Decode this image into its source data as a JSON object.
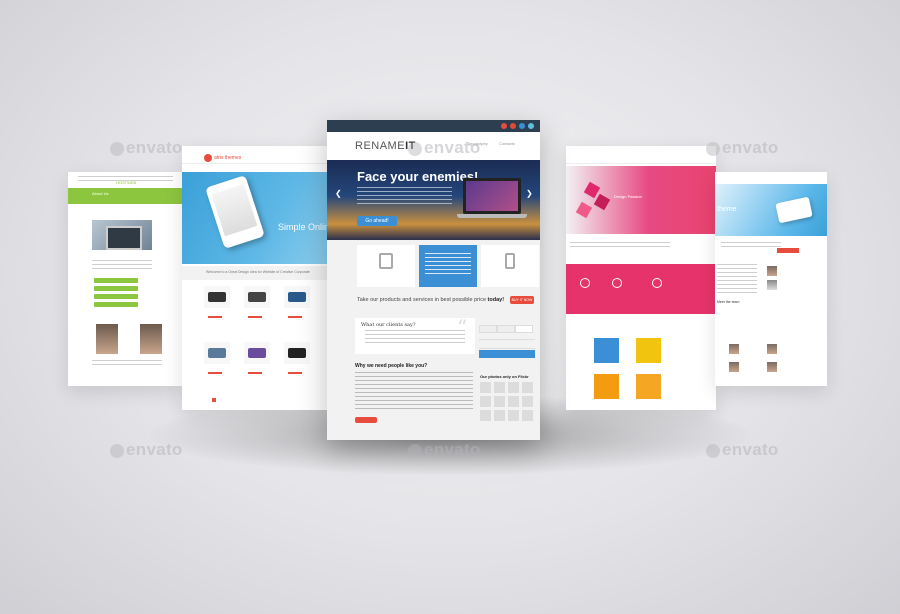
{
  "left_page": {
    "nav_label": "HOSTWEB",
    "section_title": "About Us"
  },
  "second_page": {
    "logo_text": "atrix themes",
    "hero_title": "Simple Online",
    "info_bar": "Welcome to a Great Design Idea for Website of Creative Corporate"
  },
  "center_page": {
    "brand_prefix": "RENAME",
    "brand_suffix": "IT",
    "nav_items": [
      "Typography",
      "Contacts"
    ],
    "hero_title": "Face your enemies!",
    "hero_button": "Go ahead!",
    "promo_text": "Take our products and services in best possible price",
    "promo_bold": "today!",
    "buy_button": "BUY IT NOW",
    "quote_title": "What our clients say?",
    "why_heading": "Why we need people like you?",
    "flickr_heading": "Our photos only on Flickr"
  },
  "fourth_page": {
    "hero_caption": "Design Passion"
  },
  "right_page": {
    "hero_title": "theme",
    "section_title": "Meet the team"
  },
  "watermarks": [
    "envato",
    "envato",
    "envato",
    "envato",
    "envato",
    "envato",
    "envato",
    "envato"
  ],
  "colors": {
    "green": "#8cc63f",
    "blue": "#3b8fd4",
    "red": "#e74c3c",
    "pink": "#e6336b",
    "navy": "#2c3e50"
  }
}
